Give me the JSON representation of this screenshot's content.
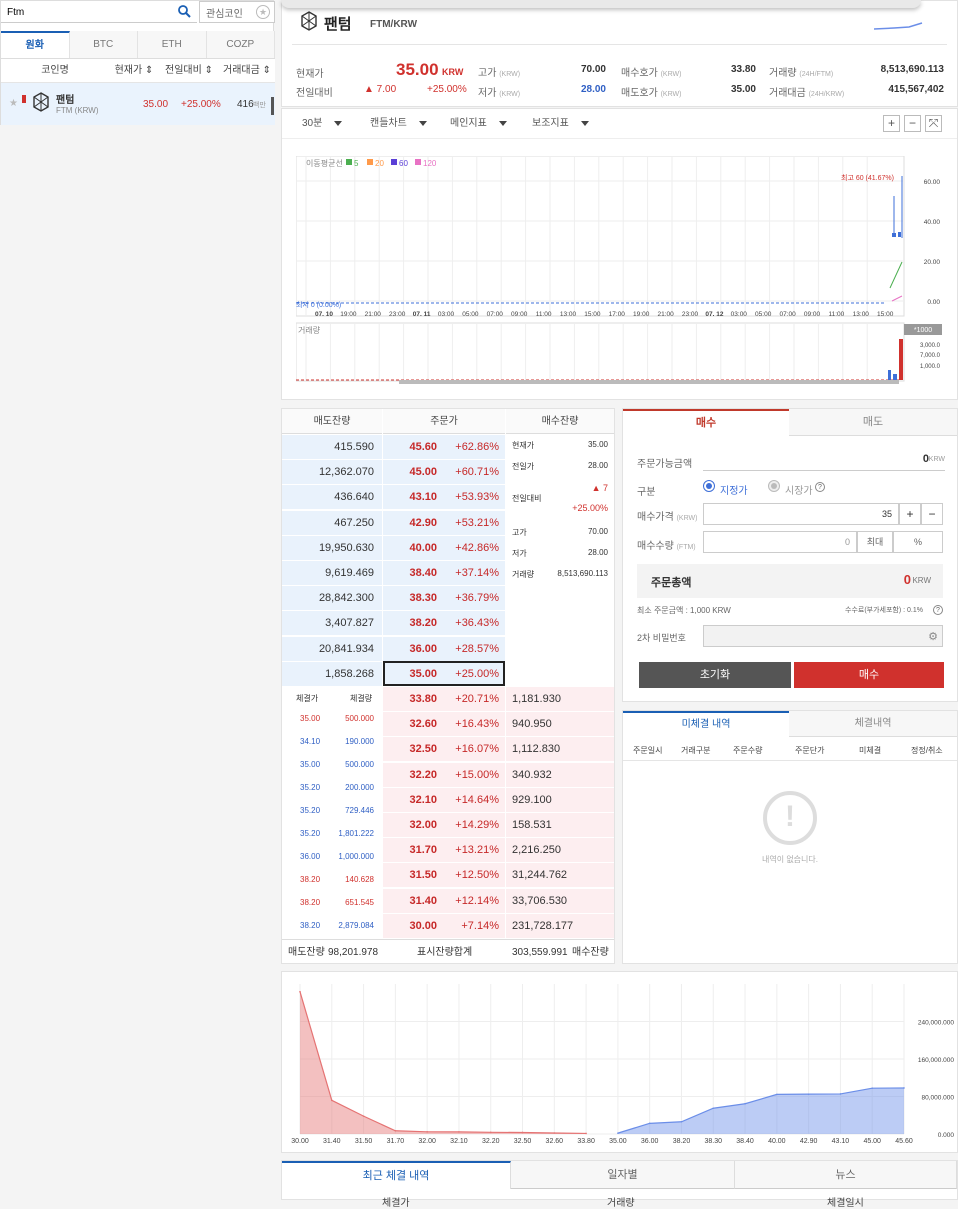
{
  "search": {
    "value": "Ftm",
    "fav_label": "관심코인"
  },
  "market_tabs": [
    "원화",
    "BTC",
    "ETH",
    "COZP"
  ],
  "coin_list": {
    "headers": [
      "코인명",
      "현재가 ⇕",
      "전일대비 ⇕",
      "거래대금 ⇕"
    ],
    "row": {
      "name": "팬텀",
      "symbol": "FTM (KRW)",
      "price": "35.00",
      "change": "+25.00%",
      "volume": "416",
      "volume_unit": "백만"
    }
  },
  "header": {
    "name": "팬텀",
    "pair": "FTM/KRW",
    "cur_label": "현재가",
    "price": "35.00",
    "price_unit": "KRW",
    "prev_label": "전일대비",
    "prev_change": "▲ 7.00",
    "prev_pct": "+25.00%",
    "high_label": "고가",
    "high_unit": "(KRW)",
    "high": "70.00",
    "low_label": "저가",
    "low_unit": "(KRW)",
    "low": "28.00",
    "bid_label": "매수호가",
    "bid_unit": "(KRW)",
    "bid": "33.80",
    "ask_label": "매도호가",
    "ask_unit": "(KRW)",
    "ask": "35.00",
    "vol_label": "거래량",
    "vol_unit": "(24H/FTM)",
    "vol": "8,513,690.113",
    "amt_label": "거래대금",
    "amt_unit": "(24H/KRW)",
    "amt": "415,567,402"
  },
  "chart_toolbar": {
    "interval": "30분",
    "type": "캔들차트",
    "main_ind": "메인지표",
    "sub_ind": "보조지표",
    "plus": "+",
    "minus": "−",
    "expand": "⤧"
  },
  "price_chart": {
    "ma_label": "이동평균선",
    "ma": [
      {
        "n": "5",
        "color": "#4caf50"
      },
      {
        "n": "20",
        "color": "#ff9a4a"
      },
      {
        "n": "60",
        "color": "#5b3fd6"
      },
      {
        "n": "120",
        "color": "#e872c4"
      }
    ],
    "high_note": "최고 60 (41.67%)",
    "low_note": "최저 0 (0.00%)",
    "y_ticks": [
      "60.00",
      "40.00",
      "20.00",
      "0.00"
    ],
    "x_ticks": [
      "07. 10",
      "19:00",
      "21:00",
      "23:00",
      "07. 11",
      "03:00",
      "05:00",
      "07:00",
      "09:00",
      "11:00",
      "13:00",
      "15:00",
      "17:00",
      "19:00",
      "21:00",
      "23:00",
      "07. 12",
      "03:00",
      "05:00",
      "07:00",
      "09:00",
      "11:00",
      "13:00",
      "15:00"
    ],
    "vol_label": "거래량",
    "vol_scale": "*1000",
    "vol_ticks": [
      "3,000.0",
      "7,000.0",
      "1,000.0"
    ]
  },
  "orderbook": {
    "headers": [
      "매도잔량",
      "주문가",
      "매수잔량"
    ],
    "asks": [
      {
        "amount": "415.590",
        "price": "45.60",
        "pct": "+62.86%"
      },
      {
        "amount": "12,362.070",
        "price": "45.00",
        "pct": "+60.71%"
      },
      {
        "amount": "436.640",
        "price": "43.10",
        "pct": "+53.93%"
      },
      {
        "amount": "467.250",
        "price": "42.90",
        "pct": "+53.21%"
      },
      {
        "amount": "19,950.630",
        "price": "40.00",
        "pct": "+42.86%"
      },
      {
        "amount": "9,619.469",
        "price": "38.40",
        "pct": "+37.14%"
      },
      {
        "amount": "28,842.300",
        "price": "38.30",
        "pct": "+36.79%"
      },
      {
        "amount": "3,407.827",
        "price": "38.20",
        "pct": "+36.43%"
      },
      {
        "amount": "20,841.934",
        "price": "36.00",
        "pct": "+28.57%"
      },
      {
        "amount": "1,858.268",
        "price": "35.00",
        "pct": "+25.00%"
      }
    ],
    "bids": [
      {
        "price": "33.80",
        "pct": "+20.71%",
        "amount": "1,181.930"
      },
      {
        "price": "32.60",
        "pct": "+16.43%",
        "amount": "940.950"
      },
      {
        "price": "32.50",
        "pct": "+16.07%",
        "amount": "1,112.830"
      },
      {
        "price": "32.20",
        "pct": "+15.00%",
        "amount": "340.932"
      },
      {
        "price": "32.10",
        "pct": "+14.64%",
        "amount": "929.100"
      },
      {
        "price": "32.00",
        "pct": "+14.29%",
        "amount": "158.531"
      },
      {
        "price": "31.70",
        "pct": "+13.21%",
        "amount": "2,216.250"
      },
      {
        "price": "31.50",
        "pct": "+12.50%",
        "amount": "31,244.762"
      },
      {
        "price": "31.40",
        "pct": "+12.14%",
        "amount": "33,706.530"
      },
      {
        "price": "30.00",
        "pct": "+7.14%",
        "amount": "231,728.177"
      }
    ],
    "info": {
      "cur_label": "현재가",
      "cur": "35.00",
      "prev_label": "전일가",
      "prev": "28.00",
      "chg_label": "전일대비",
      "chg": "▲ 7",
      "chg_pct": "+25.00%",
      "high_label": "고가",
      "high": "70.00",
      "low_label": "저가",
      "low": "28.00",
      "vol_label": "거래량",
      "vol": "8,513,690.113"
    },
    "trades_headers": [
      "체결가",
      "체결량"
    ],
    "trades": [
      {
        "price": "35.00",
        "qty": "500.000",
        "side": "red"
      },
      {
        "price": "34.10",
        "qty": "190.000",
        "side": "blue"
      },
      {
        "price": "35.00",
        "qty": "500.000",
        "side": "blue"
      },
      {
        "price": "35.20",
        "qty": "200.000",
        "side": "blue"
      },
      {
        "price": "35.20",
        "qty": "729.446",
        "side": "blue"
      },
      {
        "price": "35.20",
        "qty": "1,801.222",
        "side": "blue"
      },
      {
        "price": "36.00",
        "qty": "1,000.000",
        "side": "blue"
      },
      {
        "price": "38.20",
        "qty": "140.628",
        "side": "red"
      },
      {
        "price": "38.20",
        "qty": "651.545",
        "side": "red"
      },
      {
        "price": "38.20",
        "qty": "2,879.084",
        "side": "blue"
      }
    ],
    "footer": {
      "ask_total_label": "매도잔량",
      "ask_total": "98,201.978",
      "mid_label": "표시잔량합계",
      "bid_total": "303,559.991",
      "bid_total_label": "매수잔량"
    }
  },
  "order_form": {
    "tab_buy": "매수",
    "tab_sell": "매도",
    "avail_label": "주문가능금액",
    "avail": "0",
    "avail_unit": "KRW",
    "type_label": "구분",
    "opt_limit": "지정가",
    "opt_market": "시장가",
    "price_label": "매수가격",
    "price_unit": "(KRW)",
    "price": "35",
    "qty_label": "매수수량",
    "qty_unit": "(FTM)",
    "qty": "0",
    "max_label": "최대",
    "pct_label": "%",
    "total_label": "주문총액",
    "total": "0",
    "total_unit": "KRW",
    "min_label": "최소 주문금액 : 1,000 KRW",
    "fee_label": "수수료(부가세포함) : 0.1%",
    "pw_label": "2차 비밀번호",
    "reset_label": "초기화",
    "submit_label": "매수"
  },
  "open_orders": {
    "tab_active": "미체결 내역",
    "tab_other": "체결내역",
    "headers": [
      "주문일시",
      "거래구분",
      "주문수량",
      "주문단가",
      "미체결",
      "정정/취소"
    ],
    "empty": "내역이 없습니다."
  },
  "chart_data": {
    "type": "area",
    "bid_side": {
      "x": [
        30.0,
        31.4,
        31.5,
        31.7,
        32.0,
        32.1,
        32.2,
        32.5,
        32.6,
        33.8
      ],
      "y": [
        303560,
        71832,
        38125,
        6880,
        4664,
        4505,
        3576,
        3235,
        2122,
        1182
      ]
    },
    "ask_side": {
      "x": [
        35.0,
        36.0,
        38.2,
        38.3,
        38.4,
        40.0,
        42.9,
        43.1,
        45.0,
        45.6
      ],
      "y": [
        1858,
        22700,
        26108,
        54950,
        64570,
        84520,
        84987,
        85424,
        97786,
        98202
      ]
    },
    "x_ticks": [
      "30.00",
      "31.40",
      "31.50",
      "31.70",
      "32.00",
      "32.10",
      "32.20",
      "32.50",
      "32.60",
      "33.80",
      "35.00",
      "36.00",
      "38.20",
      "38.30",
      "38.40",
      "40.00",
      "42.90",
      "43.10",
      "45.00",
      "45.60"
    ],
    "y_ticks": [
      "0.000",
      "80,000.000",
      "160,000.000",
      "240,000.000"
    ],
    "ylim": [
      0,
      320000
    ],
    "grid": true,
    "colors": {
      "bid": "#e57373",
      "ask": "#6b8ee8"
    }
  },
  "bottom_tabs": {
    "tabs": [
      "최근 체결 내역",
      "일자별",
      "뉴스"
    ],
    "cols": [
      "체결가",
      "거래량",
      "체결일시"
    ]
  }
}
